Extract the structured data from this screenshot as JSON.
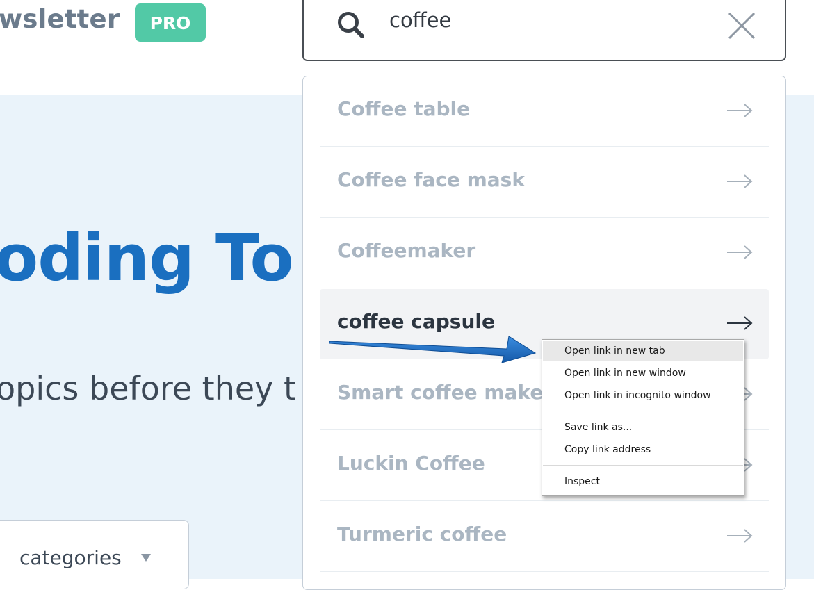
{
  "header": {
    "brand_text": "wsletter",
    "pro_badge": "PRO"
  },
  "hero": {
    "title": "oding To",
    "subtitle": "opics before they t",
    "categories_label": "categories"
  },
  "search": {
    "value": "coffee",
    "search_icon": "search-icon",
    "clear_icon": "close-icon"
  },
  "suggestions": [
    {
      "label": "Coffee table"
    },
    {
      "label": "Coffee face mask"
    },
    {
      "label": "Coffeemaker"
    },
    {
      "label": "coffee capsule"
    },
    {
      "label": "Smart coffee maker"
    },
    {
      "label": "Luckin Coffee"
    },
    {
      "label": "Turmeric coffee"
    }
  ],
  "context_menu": {
    "items": [
      "Open link in new tab",
      "Open link in new window",
      "Open link in incognito window",
      "Save link as...",
      "Copy link address",
      "Inspect"
    ]
  },
  "colors": {
    "accent_blue": "#1a6fc0",
    "pro_green": "#52c9a6",
    "hero_bg": "#eaf3fa",
    "annotation_arrow": "#1c6ac0"
  }
}
